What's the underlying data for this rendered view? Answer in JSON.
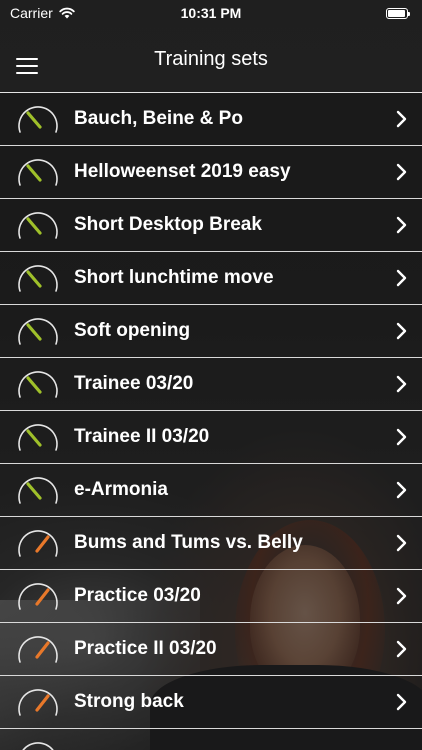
{
  "status": {
    "carrier": "Carrier",
    "time": "10:31 PM"
  },
  "nav": {
    "title": "Training sets"
  },
  "colors": {
    "easy": "#9fc02a",
    "medium": "#e8782a"
  },
  "training_sets": [
    {
      "label": "Bauch, Beine & Po",
      "level": "easy"
    },
    {
      "label": "Helloweenset 2019 easy",
      "level": "easy"
    },
    {
      "label": "Short Desktop Break",
      "level": "easy"
    },
    {
      "label": "Short lunchtime move",
      "level": "easy"
    },
    {
      "label": "Soft opening",
      "level": "easy"
    },
    {
      "label": "Trainee 03/20",
      "level": "easy"
    },
    {
      "label": "Trainee II 03/20",
      "level": "easy"
    },
    {
      "label": "e-Armonia",
      "level": "easy"
    },
    {
      "label": "Bums and Tums vs. Belly",
      "level": "medium"
    },
    {
      "label": "Practice 03/20",
      "level": "medium"
    },
    {
      "label": "Practice II 03/20",
      "level": "medium"
    },
    {
      "label": "Strong back",
      "level": "medium"
    }
  ]
}
